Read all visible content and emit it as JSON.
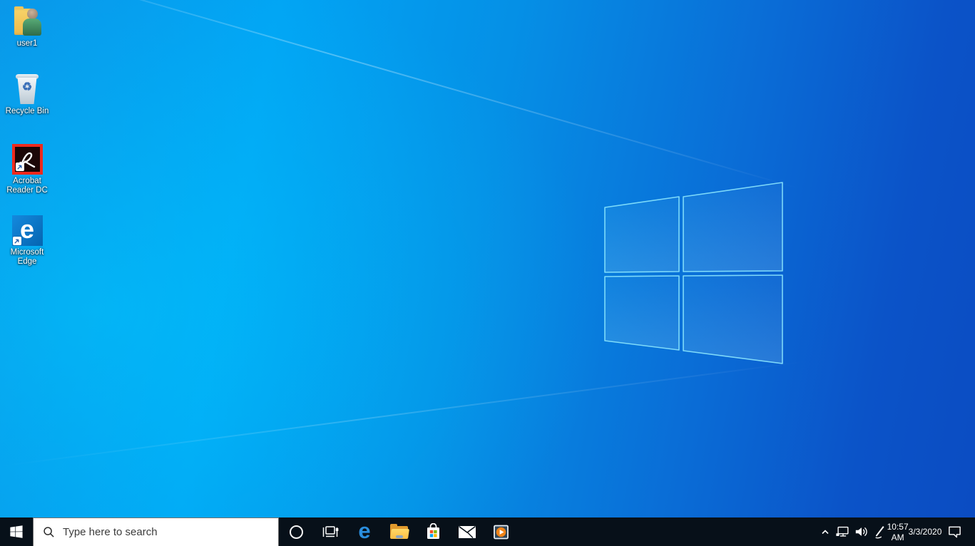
{
  "wallpaper": {
    "theme": "windows-10-light-blue",
    "primary_color": "#02a4f4",
    "deep_color": "#0b4cc2",
    "logo_edge_color": "#8ce6ff"
  },
  "desktop": {
    "icons": [
      {
        "name": "user1-folder",
        "icon": "user-folder-icon",
        "label": "user1"
      },
      {
        "name": "recycle-bin",
        "icon": "recycle-bin-icon",
        "label": "Recycle Bin"
      },
      {
        "name": "acrobat-reader-dc",
        "icon": "acrobat-icon",
        "label": "Acrobat Reader DC"
      },
      {
        "name": "microsoft-edge",
        "icon": "edge-e-icon",
        "label": "Microsoft Edge"
      }
    ]
  },
  "taskbar": {
    "start": {
      "icon": "windows-logo-icon"
    },
    "search": {
      "icon": "magnifier-icon",
      "placeholder": "Type here to search",
      "value": ""
    },
    "apps": [
      {
        "name": "cortana",
        "icon": "cortana-ring-icon"
      },
      {
        "name": "task-view",
        "icon": "task-view-icon"
      },
      {
        "name": "microsoft-edge",
        "icon": "edge-e-icon"
      },
      {
        "name": "file-explorer",
        "icon": "folder-icon"
      },
      {
        "name": "microsoft-store",
        "icon": "store-bag-icon"
      },
      {
        "name": "mail",
        "icon": "envelope-icon"
      },
      {
        "name": "media-player",
        "icon": "play-circle-icon"
      }
    ],
    "tray": {
      "hidden_icons": {
        "icon": "chevron-up-icon"
      },
      "network": {
        "icon": "network-icon"
      },
      "volume": {
        "icon": "volume-icon"
      },
      "ink": {
        "icon": "pen-icon"
      },
      "clock": {
        "time": "10:57 AM",
        "date": "3/3/2020"
      },
      "action_center": {
        "icon": "action-center-icon"
      }
    },
    "colors": {
      "taskbar_bg": "#071019",
      "acrobat_red": "#ee2a1d",
      "edge_blue": "#0a7cd7",
      "store_red": "#f25022",
      "store_green": "#7fba00",
      "store_blue": "#00a4ef",
      "store_yellow": "#ffb900",
      "media_orange": "#ef8318"
    }
  }
}
